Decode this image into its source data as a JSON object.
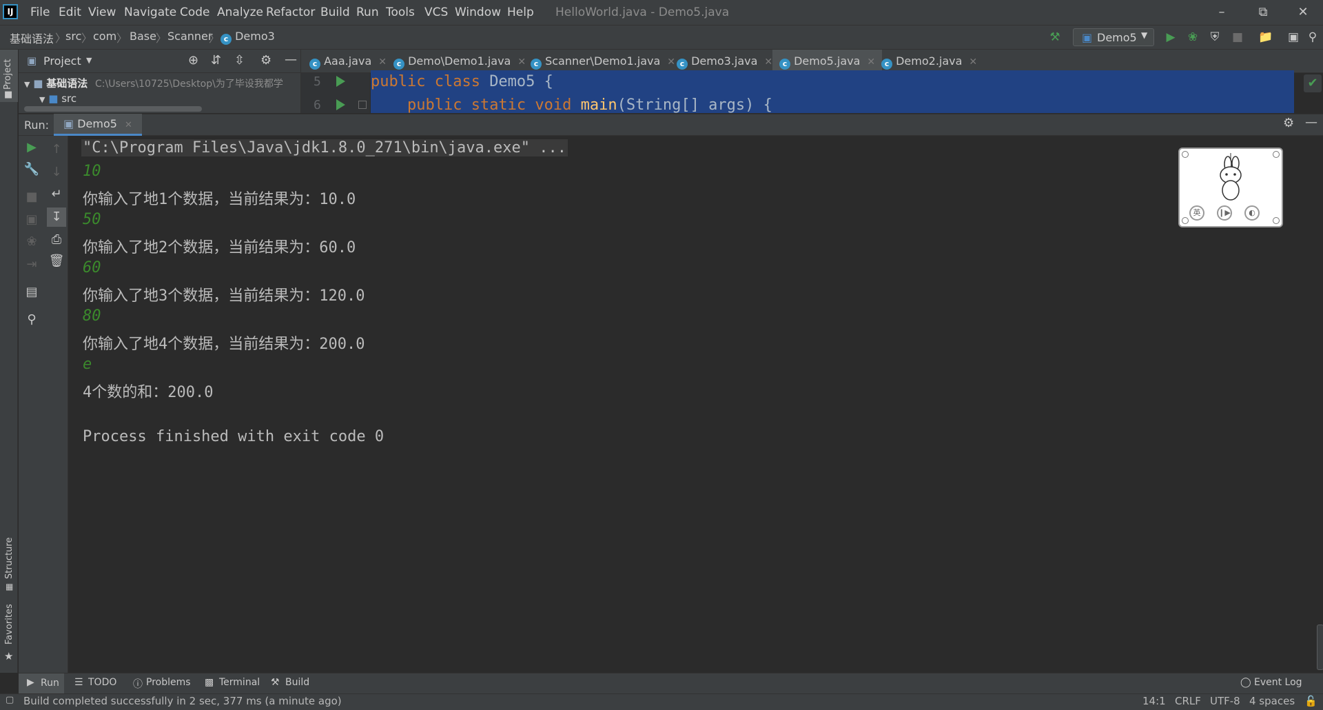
{
  "menubar": {
    "items": [
      "File",
      "Edit",
      "View",
      "Navigate",
      "Code",
      "Analyze",
      "Refactor",
      "Build",
      "Run",
      "Tools",
      "VCS",
      "Window",
      "Help"
    ],
    "window_title": "HelloWorld.java - Demo5.java"
  },
  "breadcrumb": {
    "items": [
      "基础语法",
      "src",
      "com",
      "Base",
      "Scanner",
      "Demo3"
    ]
  },
  "run_config": {
    "selected": "Demo5"
  },
  "project_panel": {
    "title": "Project",
    "root_name": "基础语法",
    "root_path": "C:\\Users\\10725\\Desktop\\为了毕设我都学",
    "child": "src"
  },
  "left_stripe": {
    "project": "Project",
    "structure": "Structure",
    "favorites": "Favorites"
  },
  "editor_tabs": [
    {
      "label": "Aaa.java"
    },
    {
      "label": "Demo\\Demo1.java"
    },
    {
      "label": "Scanner\\Demo1.java"
    },
    {
      "label": "Demo3.java"
    },
    {
      "label": "Demo5.java",
      "active": true
    },
    {
      "label": "Demo2.java"
    }
  ],
  "editor": {
    "lines": [
      {
        "number": "5",
        "text": "public class Demo5 {"
      },
      {
        "number": "6",
        "text": "    public static void main(String[] args) {"
      }
    ]
  },
  "run_window": {
    "label": "Run:",
    "tab": "Demo5",
    "console": [
      {
        "text": "\"C:\\Program Files\\Java\\jdk1.8.0_271\\bin\\java.exe\" ...",
        "kind": "cmd"
      },
      {
        "text": "10",
        "kind": "input"
      },
      {
        "text": "你输入了地1个数据，当前结果为：10.0",
        "kind": "out"
      },
      {
        "text": "50",
        "kind": "input"
      },
      {
        "text": "你输入了地2个数据，当前结果为：60.0",
        "kind": "out"
      },
      {
        "text": "60",
        "kind": "input"
      },
      {
        "text": "你输入了地3个数据，当前结果为：120.0",
        "kind": "out"
      },
      {
        "text": "80",
        "kind": "input"
      },
      {
        "text": "你输入了地4个数据，当前结果为：200.0",
        "kind": "out"
      },
      {
        "text": "e",
        "kind": "input"
      },
      {
        "text": "4个数的和：200.0",
        "kind": "out"
      },
      {
        "text": "",
        "kind": "out"
      },
      {
        "text": "Process finished with exit code 0",
        "kind": "out"
      }
    ]
  },
  "pet_widget": {
    "btn_lang": "英"
  },
  "bottom_tools": {
    "run": "Run",
    "todo": "TODO",
    "problems": "Problems",
    "terminal": "Terminal",
    "build": "Build",
    "event_log": "Event Log"
  },
  "status_bar": {
    "message": "Build completed successfully in 2 sec, 377 ms (a minute ago)",
    "position": "14:1",
    "line_sep": "CRLF",
    "encoding": "UTF-8",
    "indent": "4 spaces"
  },
  "colors": {
    "bg": "#2b2b2b",
    "panel": "#3c3f41",
    "selection": "#214283",
    "keyword": "#cc7832",
    "method": "#ffc66d",
    "input_text": "#3b8a2c",
    "run_green": "#499c54"
  }
}
